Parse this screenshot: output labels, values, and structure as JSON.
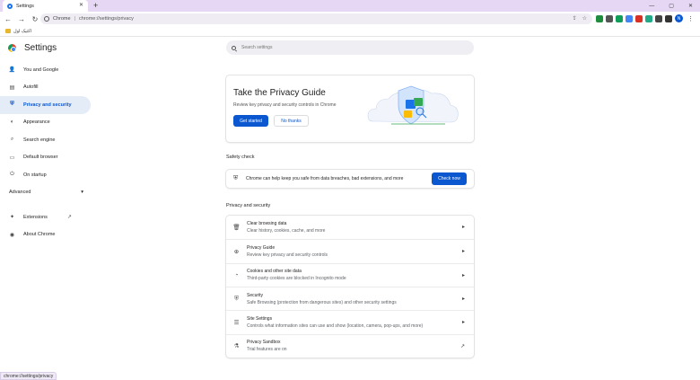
{
  "window": {
    "tab_title": "Settings",
    "tab_close": "✕",
    "new_tab": "+",
    "minimize": "—",
    "maximize": "▢",
    "close": "✕"
  },
  "toolbar": {
    "back": "←",
    "forward": "→",
    "reload": "↻",
    "scheme_label": "Chrome",
    "separator": "|",
    "url": "chrome://settings/privacy",
    "share": "⇪",
    "bookmark_star": "☆",
    "avatar_letter": "N",
    "menu": "⋮",
    "extension_colors": [
      "#1e8e3e",
      "#555555",
      "#0f9d58",
      "#4285f4",
      "#d93025",
      "#22aa88",
      "#444444",
      "#333333"
    ]
  },
  "bookmarks": {
    "folder_label": "اکتیک اول"
  },
  "header": {
    "title": "Settings",
    "search_placeholder": "Search settings"
  },
  "sidebar": {
    "items": [
      {
        "label": "You and Google",
        "icon": "👤"
      },
      {
        "label": "Autofill",
        "icon": "▤"
      },
      {
        "label": "Privacy and security",
        "icon": "⛨"
      },
      {
        "label": "Appearance",
        "icon": "◐"
      },
      {
        "label": "Search engine",
        "icon": "⌕"
      },
      {
        "label": "Default browser",
        "icon": "▭"
      },
      {
        "label": "On startup",
        "icon": "⏻"
      }
    ],
    "advanced_label": "Advanced",
    "advanced_chevron": "▾",
    "bottom_items": [
      {
        "label": "Extensions",
        "icon": "✦"
      },
      {
        "label": "About Chrome",
        "icon": "◉"
      }
    ],
    "external_link": "↗"
  },
  "privacy_guide": {
    "title": "Take the Privacy Guide",
    "description": "Review key privacy and security controls in Chrome",
    "get_started": "Get started",
    "no_thanks": "No thanks"
  },
  "safety_check": {
    "section_title": "Safety check",
    "text": "Chrome can help keep you safe from data breaches, bad extensions, and more",
    "button": "Check now"
  },
  "privacy_security": {
    "section_title": "Privacy and security",
    "rows": [
      {
        "title": "Clear browsing data",
        "subtitle": "Clear history, cookies, cache, and more",
        "icon": "🗑",
        "arrow": "▸"
      },
      {
        "title": "Privacy Guide",
        "subtitle": "Review key privacy and security controls",
        "icon": "⊕",
        "arrow": "▸"
      },
      {
        "title": "Cookies and other site data",
        "subtitle": "Third-party cookies are blocked in Incognito mode",
        "icon": "◔",
        "arrow": "▸"
      },
      {
        "title": "Security",
        "subtitle": "Safe Browsing (protection from dangerous sites) and other security settings",
        "icon": "⛨",
        "arrow": "▸"
      },
      {
        "title": "Site Settings",
        "subtitle": "Controls what information sites can use and show (location, camera, pop-ups, and more)",
        "icon": "☰",
        "arrow": "▸"
      },
      {
        "title": "Privacy Sandbox",
        "subtitle": "Trial features are on",
        "icon": "⚗",
        "arrow": "↗"
      }
    ]
  },
  "status_bar": {
    "hover_url": "chrome://settings/privacy"
  }
}
